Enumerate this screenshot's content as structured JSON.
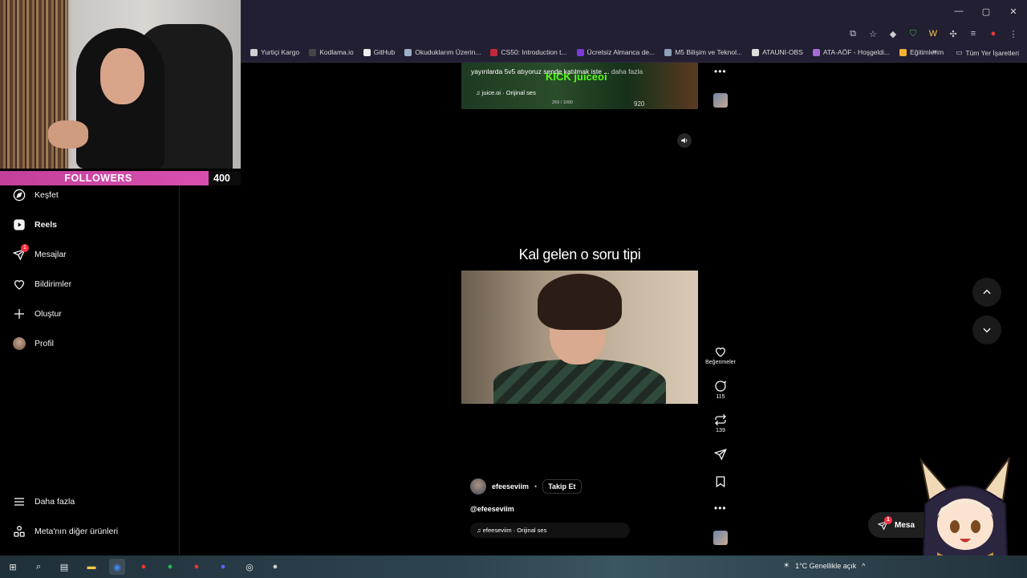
{
  "browser": {
    "window_controls": [
      "—",
      "▢",
      "✕"
    ],
    "bookmarks": [
      {
        "label": "Yurtiçi Kargo",
        "color": "#cfcfcf"
      },
      {
        "label": "Kodlama.io",
        "color": "#444444"
      },
      {
        "label": "GitHub",
        "color": "#eeeeee"
      },
      {
        "label": "Okuduklarım Üzerin...",
        "color": "#9ab0c8"
      },
      {
        "label": "CS50: Introduction t...",
        "color": "#c0283c"
      },
      {
        "label": "Ücretsiz Almanca de...",
        "color": "#7a3bd8"
      },
      {
        "label": "M5 Bilişim ve Teknol...",
        "color": "#8fa0b8"
      },
      {
        "label": "ATAUNI-OBS",
        "color": "#dddddd"
      },
      {
        "label": "ATA-AÖF - Hoşgeldi...",
        "color": "#a56cd8"
      },
      {
        "label": "Eğitimlerim",
        "color": "#f2b233"
      }
    ],
    "bookmarks_more": "»",
    "all_bookmarks": "Tüm Yer İşaretleri"
  },
  "overlay": {
    "followers_label": "FOLLOWERS",
    "followers_count": "400"
  },
  "sidebar": {
    "items": [
      {
        "label": "Keşfet",
        "icon": "compass-icon",
        "top": 0
      },
      {
        "label": "Reels",
        "icon": "reels-icon",
        "bold": true
      },
      {
        "label": "Mesajlar",
        "icon": "messenger-icon",
        "badge": "1"
      },
      {
        "label": "Bildirimler",
        "icon": "heart-icon"
      },
      {
        "label": "Oluştur",
        "icon": "plus-icon"
      },
      {
        "label": "Profil",
        "icon": "avatar"
      }
    ],
    "more_label": "Daha fazla",
    "meta_label": "Meta'nın diğer ürünleri"
  },
  "prev_reel": {
    "caption": "yayınlarda 5v5 atıyoruz sende katılmak iste ...",
    "caption_more": "daha fazla",
    "brand": "KICK juiceoi",
    "audio": "juice.oi · Orijinal ses",
    "stat_small": "269 / 1090",
    "stat_score": "920"
  },
  "reel": {
    "subtitle": "Kal gelen o soru tipi",
    "author": "efeeseviim",
    "separator": "•",
    "follow_label": "Takip Et",
    "caption": "@efeeseviim",
    "audio": "efeeseviim · Orijinal ses",
    "likes_label": "Beğenmeler",
    "comments_count": "115",
    "reposts_count": "139"
  },
  "messages_pill": {
    "label": "Mesa",
    "badge": "1"
  },
  "taskbar": {
    "weather": "1°C  Genellikle açık"
  }
}
